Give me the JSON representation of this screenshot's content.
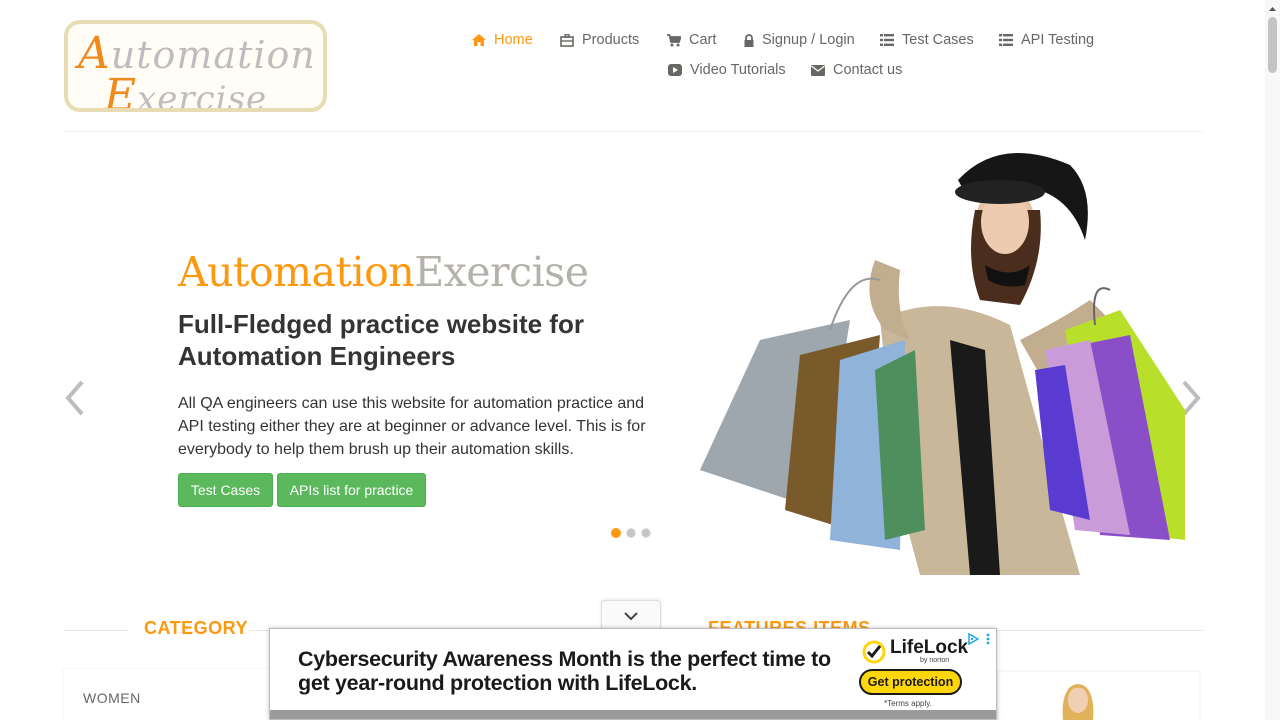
{
  "logo": {
    "line1_first": "A",
    "line1_rest": "utomation",
    "line2_first": "E",
    "line2_rest": "xercise"
  },
  "nav": {
    "items": [
      {
        "label": "Home",
        "icon": "home-icon",
        "active": true
      },
      {
        "label": "Products",
        "icon": "products-icon"
      },
      {
        "label": "Cart",
        "icon": "cart-icon"
      },
      {
        "label": "Signup / Login",
        "icon": "lock-icon"
      },
      {
        "label": "Test Cases",
        "icon": "list-icon"
      },
      {
        "label": "API Testing",
        "icon": "list-icon"
      },
      {
        "label": "Video Tutorials",
        "icon": "youtube-icon"
      },
      {
        "label": "Contact us",
        "icon": "envelope-icon"
      }
    ]
  },
  "hero": {
    "brand_a": "Automation",
    "brand_b": "Exercise",
    "headline": "Full-Fledged practice website for Automation Engineers",
    "description": "All QA engineers can use this website for automation practice and API testing either they are at beginner or advance level. This is for everybody to help them brush up their automation skills.",
    "btn_test_cases": "Test Cases",
    "btn_apis": "APIs list for practice",
    "active_slide": 1,
    "slide_count": 3
  },
  "sections": {
    "category_title": "CATEGORY",
    "features_title": "FEATURES ITEMS",
    "category_women": "WOMEN"
  },
  "ad": {
    "text": "Cybersecurity Awareness Month is the perfect time to get year-round protection with LifeLock.",
    "brand": "LifeLock",
    "brand_sub": "by norton",
    "cta": "Get protection",
    "terms": "*Terms apply."
  },
  "colors": {
    "accent": "#fe980f",
    "green_button": "#5cb85c",
    "ad_cta": "#ffd60a"
  }
}
